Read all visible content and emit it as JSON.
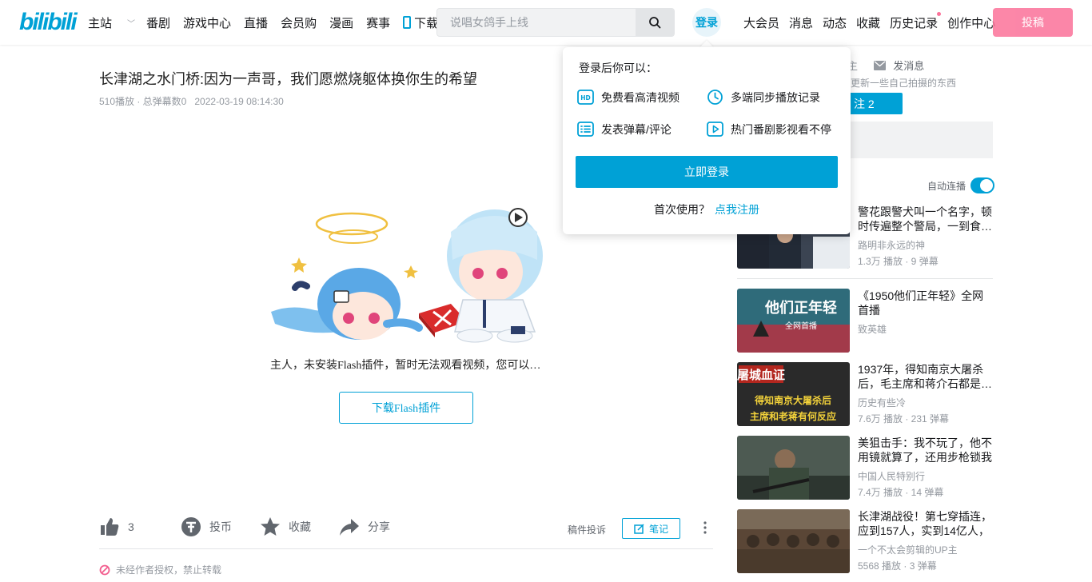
{
  "header": {
    "logo": "bilibili",
    "nav": [
      "主站",
      "番剧",
      "游戏中心",
      "直播",
      "会员购",
      "漫画",
      "赛事",
      "下载APP"
    ],
    "search_placeholder": "说唱女鸽手上线",
    "login": "登录",
    "right_nav": [
      "大会员",
      "消息",
      "动态",
      "收藏",
      "历史记录",
      "创作中心"
    ],
    "upload": "投稿"
  },
  "video": {
    "title": "长津湖之水门桥:因为一声哥，我们愿燃烧躯体换你生的希望",
    "stats": "510播放 · 总弹幕数0",
    "time": "2022-03-19 08:14:30",
    "flash_message": "主人，未安装Flash插件，暂时无法观看视频，您可以…",
    "flash_button": "下载Flash插件"
  },
  "toolbar": {
    "like_count": "3",
    "coin": "投币",
    "favorite": "收藏",
    "share": "分享",
    "report": "稿件投诉",
    "note": "笔记"
  },
  "copyright": "未经作者授权，禁止转载",
  "up": {
    "message": "发消息",
    "desc": "更新一些自己拍摄的东西",
    "follow": "注 2"
  },
  "autoplay_label": "自动连播",
  "recommendations": [
    {
      "title": "警花跟警犬叫一个名字，顿时传遍整个警局，一到食…",
      "up": "路明非永远的神",
      "stats": "1.3万 播放 · 9 弹幕"
    },
    {
      "title": "《1950他们正年轻》全网首播",
      "up": "致英雄",
      "stats": ""
    },
    {
      "title": "1937年，得知南京大屠杀后，毛主席和蒋介石都是…",
      "up": "历史有些冷",
      "stats": "7.6万 播放 · 231 弹幕"
    },
    {
      "title": "美狙击手：我不玩了，他不用镜就算了，还用步枪锁我",
      "up": "中国人民特别行",
      "stats": "7.4万 播放 · 14 弹幕"
    },
    {
      "title": "长津湖战役！第七穿插连，应到157人，实到14亿人，",
      "up": "一个不太会剪辑的UP主",
      "stats": "5568 播放 · 3 弹幕"
    }
  ],
  "thumb_texts": [
    "他们正年轻",
    "全网首播",
    "屠城血证",
    "得知南京大屠杀后",
    "主席和老蒋有何反应"
  ],
  "popup": {
    "title": "登录后你可以：",
    "perks": [
      "免费看高清视频",
      "多端同步播放记录",
      "发表弹幕/评论",
      "热门番剧影视看不停"
    ],
    "login_button": "立即登录",
    "first_use": "首次使用？",
    "register": "点我注册"
  },
  "colors": {
    "accent": "#00a1d6",
    "pink": "#fb7299"
  }
}
